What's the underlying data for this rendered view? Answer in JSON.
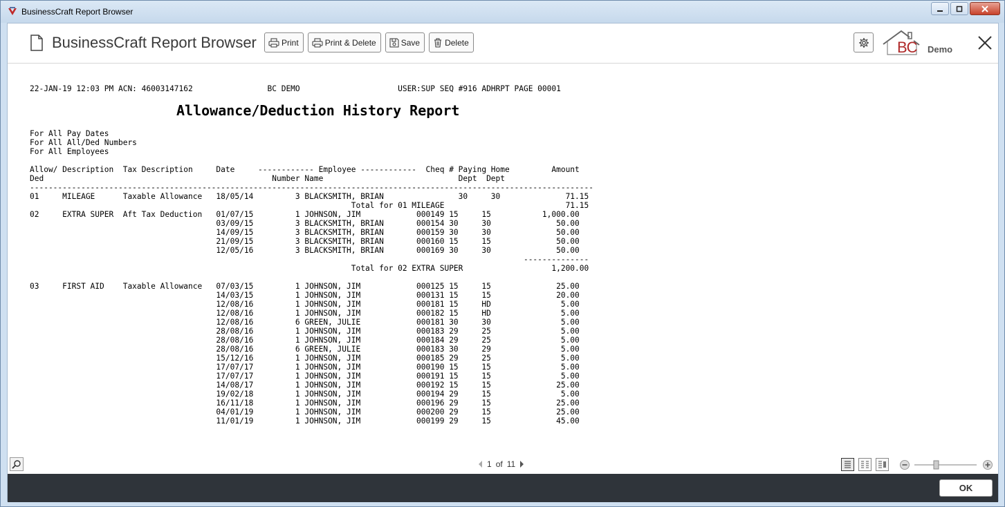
{
  "window": {
    "title": "BusinessCraft Report Browser"
  },
  "header": {
    "title": "BusinessCraft Report Browser",
    "buttons": {
      "print": "Print",
      "print_delete": "Print & Delete",
      "save": "Save",
      "delete": "Delete"
    },
    "logo_text": "BC",
    "demo": "Demo"
  },
  "report": {
    "title": "Allowance/Deduction History Report",
    "lines": [
      "22-JAN-19 12:03 PM ACN: 46003147162                BC DEMO                     USER:SUP SEQ #916 ADHRPT PAGE 00001",
      "",
      "",
      "",
      "",
      "For All Pay Dates",
      "For All All/Ded Numbers",
      "For All Employees",
      "",
      "Allow/ Description  Tax Description     Date     ------------ Employee ------------  Cheq # Paying Home         Amount",
      "Ded                                                 Number Name                             Dept  Dept",
      "-------------------------------------------------------------------------------------------------------------------------",
      "01     MILEAGE      Taxable Allowance   18/05/14         3 BLACKSMITH, BRIAN                30     30              71.15",
      "                                                                     Total for 01 MILEAGE                          71.15",
      "02     EXTRA SUPER  Aft Tax Deduction   01/07/15         1 JOHNSON, JIM            000149 15     15           1,000.00",
      "                                        03/09/15         3 BLACKSMITH, BRIAN       000154 30     30              50.00",
      "                                        14/09/15         3 BLACKSMITH, BRIAN       000159 30     30              50.00",
      "                                        21/09/15         3 BLACKSMITH, BRIAN       000160 15     15              50.00",
      "                                        12/05/16         3 BLACKSMITH, BRIAN       000169 30     30              50.00",
      "                                                                                                          --------------",
      "                                                                     Total for 02 EXTRA SUPER                   1,200.00",
      "",
      "03     FIRST AID    Taxable Allowance   07/03/15         1 JOHNSON, JIM            000125 15     15              25.00",
      "                                        14/03/15         1 JOHNSON, JIM            000131 15     15              20.00",
      "                                        12/08/16         1 JOHNSON, JIM            000181 15     HD               5.00",
      "                                        12/08/16         1 JOHNSON, JIM            000182 15     HD               5.00",
      "                                        12/08/16         6 GREEN, JULIE            000181 30     30               5.00",
      "                                        28/08/16         1 JOHNSON, JIM            000183 29     25               5.00",
      "                                        28/08/16         1 JOHNSON, JIM            000184 29     25               5.00",
      "                                        28/08/16         6 GREEN, JULIE            000183 30     29               5.00",
      "                                        15/12/16         1 JOHNSON, JIM            000185 29     25               5.00",
      "                                        17/07/17         1 JOHNSON, JIM            000190 15     15               5.00",
      "                                        17/07/17         1 JOHNSON, JIM            000191 15     15               5.00",
      "                                        14/08/17         1 JOHNSON, JIM            000192 15     15              25.00",
      "                                        19/02/18         1 JOHNSON, JIM            000194 29     15               5.00",
      "                                        16/11/18         1 JOHNSON, JIM            000196 29     15              25.00",
      "                                        04/01/19         1 JOHNSON, JIM            000200 29     15              25.00",
      "                                        11/01/19         1 JOHNSON, JIM            000199 29     15              45.00"
    ]
  },
  "footer": {
    "page_current": "1",
    "page_of": "of",
    "page_total": "11",
    "zoom_fraction": 0.35
  },
  "ok_label": "OK"
}
